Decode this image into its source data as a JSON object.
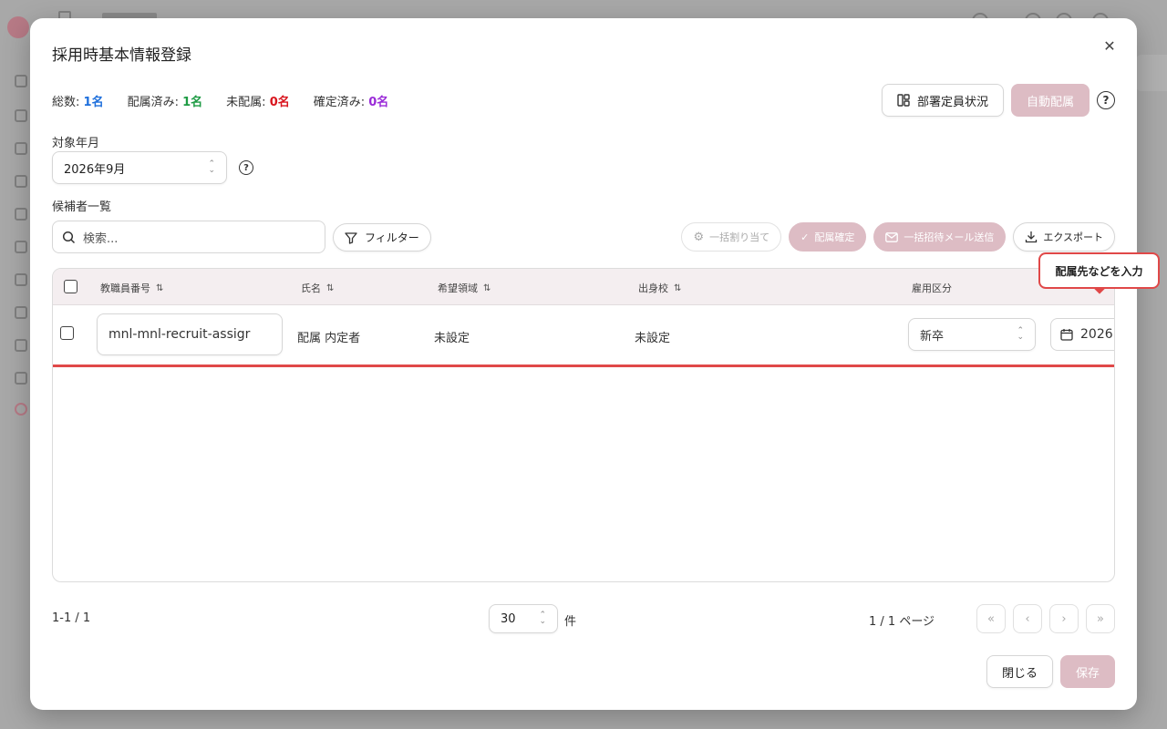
{
  "modal": {
    "title": "採用時基本情報登録",
    "close_glyph": "✕"
  },
  "stats": {
    "total_label": "総数:",
    "total_value": "1名",
    "assigned_label": "配属済み:",
    "assigned_value": "1名",
    "unassigned_label": "未配属:",
    "unassigned_value": "0名",
    "confirmed_label": "確定済み:",
    "confirmed_value": "0名"
  },
  "top_actions": {
    "dept_status_label": "部署定員状況",
    "auto_assign_label": "自動配属"
  },
  "target_month": {
    "label": "対象年月",
    "value": "2026年9月"
  },
  "candidates": {
    "label": "候補者一覧",
    "search_placeholder": "検索...",
    "filter_label": "フィルター"
  },
  "toolbar": {
    "bulk_assign_label": "一括割り当て",
    "confirm_assign_label": "配属確定",
    "bulk_invite_label": "一括招待メール送信",
    "export_label": "エクスポート"
  },
  "table": {
    "columns": [
      "教職員番号",
      "氏名",
      "希望領域",
      "出身校",
      "雇用区分"
    ],
    "rows": [
      {
        "staff_number": "mnl-mnl-recruit-assigr",
        "name": "配属 内定者",
        "desired_area": "未設定",
        "school": "未設定",
        "employment_type": "新卒",
        "date": "2026"
      }
    ]
  },
  "tooltip": {
    "text": "配属先などを入力"
  },
  "pagination": {
    "range": "1-1 / 1",
    "per_page": "30",
    "per_page_unit": "件",
    "page_of": "1 / 1 ページ"
  },
  "footer": {
    "close_label": "閉じる",
    "save_label": "保存"
  },
  "colors": {
    "accent_pink": "#ddbcc4",
    "highlight_red": "#e04848",
    "total_blue": "#1e6fdc",
    "assigned_green": "#1e9b44",
    "unassigned_red": "#d9151e",
    "confirmed_purple": "#9a2bd8"
  }
}
